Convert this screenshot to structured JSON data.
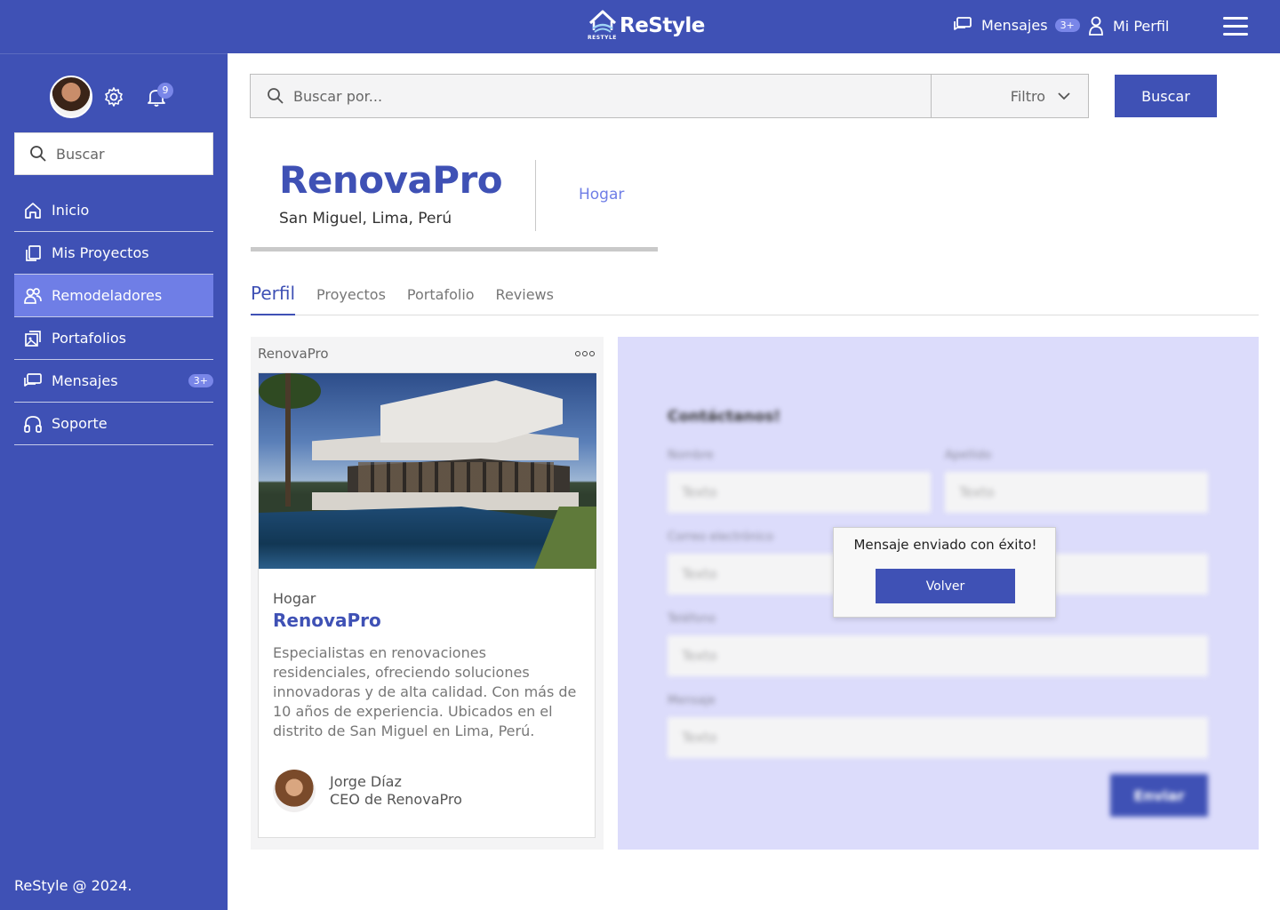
{
  "app": {
    "name": "ReStyle",
    "logo_sub": "RESTYLE"
  },
  "header": {
    "messages_label": "Mensajes",
    "messages_badge": "3+",
    "profile_label": "Mi Perfil"
  },
  "sidebar": {
    "notifications_count": "9",
    "search_placeholder": "Buscar",
    "items": [
      {
        "label": "Inicio",
        "icon": "home-icon"
      },
      {
        "label": "Mis Proyectos",
        "icon": "projects-icon"
      },
      {
        "label": "Remodeladores",
        "icon": "users-icon",
        "active": true
      },
      {
        "label": "Portafolios",
        "icon": "portfolio-icon"
      },
      {
        "label": "Mensajes",
        "icon": "messages-icon",
        "badge": "3+"
      },
      {
        "label": "Soporte",
        "icon": "headset-icon"
      }
    ],
    "footer": "ReStyle @ 2024."
  },
  "search": {
    "placeholder": "Buscar por...",
    "filter_label": "Filtro",
    "button_label": "Buscar"
  },
  "company": {
    "name": "RenovaPro",
    "location": "San Miguel, Lima, Perú",
    "category": "Hogar"
  },
  "tabs": [
    "Perfil",
    "Proyectos",
    "Portafolio",
    "Reviews"
  ],
  "card": {
    "header": "RenovaPro",
    "category": "Hogar",
    "title": "RenovaPro",
    "description": "Especialistas en renovaciones residenciales, ofreciendo soluciones innovadoras y de alta calidad. Con más de 10 años de experiencia. Ubicados en el distrito de San Miguel en Lima, Perú.",
    "person_name": "Jorge Díaz",
    "person_role": "CEO de RenovaPro"
  },
  "contact": {
    "title": "Contáctanos!",
    "first_name_label": "Nombre",
    "last_name_label": "Apellido",
    "email_label": "Correo electrónico",
    "phone_label": "Teléfono",
    "message_label": "Mensaje",
    "field_placeholder": "Texto",
    "submit_label": "Enviar"
  },
  "modal": {
    "message": "Mensaje enviado con éxito!",
    "button_label": "Volver"
  },
  "colors": {
    "primary": "#3f51b5",
    "accent_light": "#6f7ee6",
    "panel_bg": "#dcdcfb"
  }
}
